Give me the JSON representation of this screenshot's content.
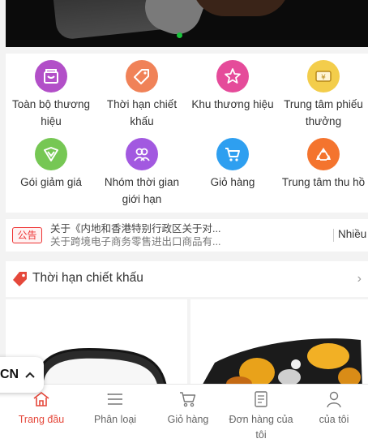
{
  "categories": [
    {
      "icon": "shopping-bag-icon",
      "color": "#b24fc8",
      "line1": "Toàn bộ thương",
      "line2": "hiệu"
    },
    {
      "icon": "price-tag-icon",
      "color": "#f08258",
      "line1": "Thời hạn chiết",
      "line2": "khấu"
    },
    {
      "icon": "star-box-icon",
      "color": "#e54b9a",
      "line1": "Khu thương hiệu",
      "line2": ""
    },
    {
      "icon": "coupon-icon",
      "color": "#f3cd4b",
      "line1": "Trung tâm phiếu",
      "line2": "thưởng"
    },
    {
      "icon": "discount-badge-icon",
      "color": "#76c754",
      "line1": "Gói giảm giá",
      "line2": ""
    },
    {
      "icon": "group-icon",
      "color": "#a259e0",
      "line1": "Nhóm thời gian",
      "line2": "giới hạn"
    },
    {
      "icon": "cart-icon",
      "color": "#2e9ff0",
      "line1": "Giỏ hàng",
      "line2": ""
    },
    {
      "icon": "recycle-icon",
      "color": "#f4742e",
      "line1": "Trung tâm thu hồ",
      "line2": ""
    }
  ],
  "notice": {
    "tag": "公告",
    "line1": "关于《内地和香港特别行政区关于对...",
    "line2": "关于跨境电子商务零售进出口商品有...",
    "more": "Nhiều"
  },
  "discount_section": {
    "title": "Thời hạn chiết khấu",
    "chevron": "›"
  },
  "language": {
    "code": "CN",
    "caret": "^"
  },
  "nav": [
    {
      "icon": "home-icon",
      "label": "Trang đầu",
      "active": true
    },
    {
      "icon": "list-icon",
      "label": "Phân loại",
      "active": false
    },
    {
      "icon": "cart-icon",
      "label": "Giỏ hàng",
      "active": false
    },
    {
      "icon": "order-icon",
      "label": "Đơn hàng của tôi",
      "active": false
    },
    {
      "icon": "user-icon",
      "label": "của tôi",
      "active": false
    }
  ],
  "colors": {
    "accent": "#e5483b",
    "notice_tag": "#e33333"
  }
}
